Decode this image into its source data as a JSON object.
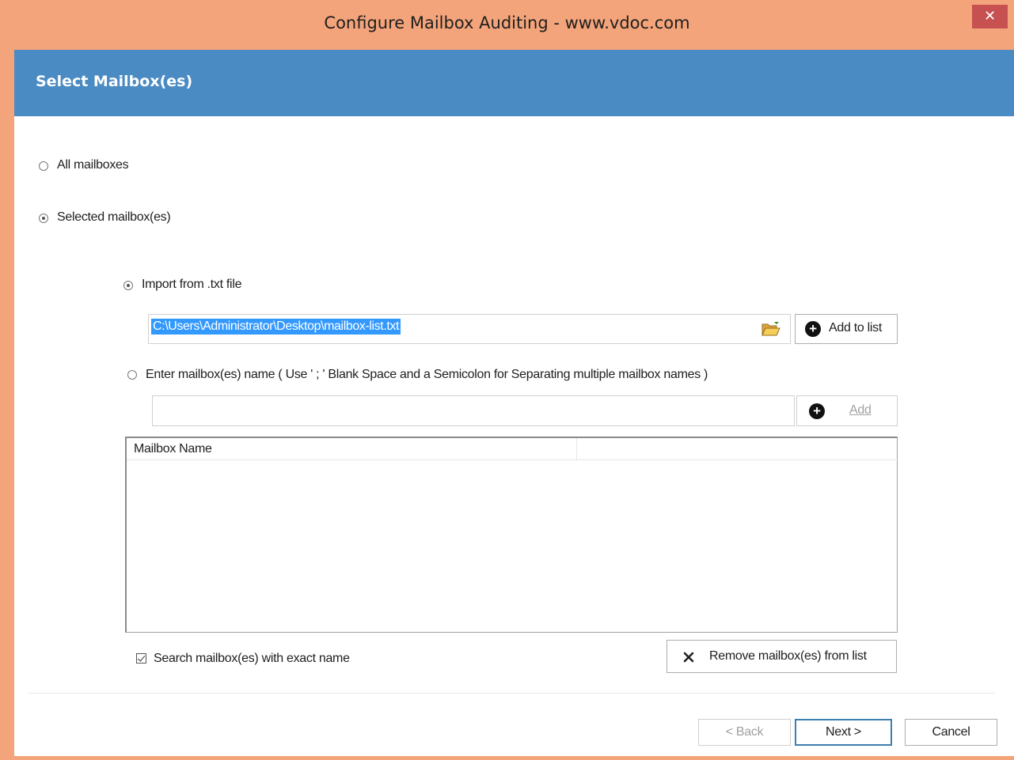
{
  "window": {
    "title": "Configure Mailbox Auditing - www.vdoc.com",
    "close_glyph": "✕"
  },
  "header": {
    "title": "Select Mailbox(es)"
  },
  "options": {
    "all_mailboxes": "All mailboxes",
    "selected_mailboxes": "Selected mailbox(es)"
  },
  "import": {
    "label": "Import from .txt file",
    "path_value": "C:\\Users\\Administrator\\Desktop\\mailbox-list.txt",
    "add_to_list_label": "Add to list"
  },
  "enter": {
    "label": "Enter mailbox(es) name ( Use ' ; ' Blank Space and a Semicolon for Separating multiple mailbox names )",
    "input_value": "",
    "add_label": "Add"
  },
  "list": {
    "columns": [
      "Mailbox Name",
      ""
    ],
    "rows": []
  },
  "exact_name": {
    "label": "Search mailbox(es) with exact name",
    "checked": true
  },
  "remove_label": "Remove mailbox(es) from list",
  "footer": {
    "back": "< Back",
    "next": "Next >",
    "cancel": "Cancel"
  },
  "colors": {
    "header_band": "#4a8bc3",
    "frame": "#f4a47a",
    "selection": "#3399ff",
    "close": "#c75050"
  }
}
